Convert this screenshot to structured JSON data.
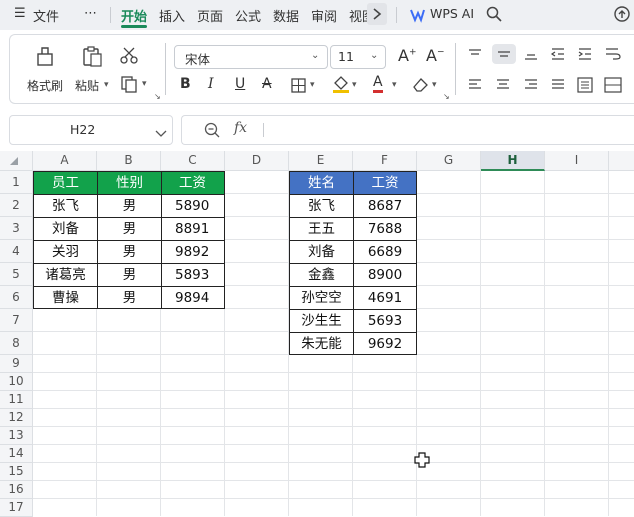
{
  "menubar": {
    "menu_label": "文件",
    "more": "⋯",
    "tabs": [
      "开始",
      "插入",
      "页面",
      "公式",
      "数据",
      "审阅",
      "视图"
    ],
    "wps_ai": "WPS AI"
  },
  "ribbon": {
    "format_painter": "格式刷",
    "paste": "粘贴",
    "font_name": "宋体",
    "font_size": "11",
    "bold": "B",
    "italic": "I",
    "underline": "U",
    "strike": "A",
    "font_color_letter": "A",
    "colors": {
      "fill": "#f0c000",
      "font": "#d32f2f"
    }
  },
  "formula_bar": {
    "cell_ref": "H22",
    "fx": "fx",
    "content": ""
  },
  "sheet": {
    "columns": [
      "A",
      "B",
      "C",
      "D",
      "E",
      "F",
      "G",
      "H",
      "I"
    ],
    "selected_column": "H",
    "rows": [
      "1",
      "2",
      "3",
      "4",
      "5",
      "6",
      "7",
      "8",
      "9",
      "10",
      "11",
      "12",
      "13",
      "14",
      "15",
      "16",
      "17"
    ],
    "table1": {
      "headers": [
        "员工",
        "性别",
        "工资"
      ],
      "rows": [
        [
          "张飞",
          "男",
          "5890"
        ],
        [
          "刘备",
          "男",
          "8891"
        ],
        [
          "关羽",
          "男",
          "9892"
        ],
        [
          "诸葛亮",
          "男",
          "5893"
        ],
        [
          "曹操",
          "男",
          "9894"
        ]
      ],
      "header_color": "#12a24b"
    },
    "table2": {
      "headers": [
        "姓名",
        "工资"
      ],
      "rows": [
        [
          "张飞",
          "8687"
        ],
        [
          "王五",
          "7688"
        ],
        [
          "刘备",
          "6689"
        ],
        [
          "金鑫",
          "8900"
        ],
        [
          "孙空空",
          "4691"
        ],
        [
          "沙生生",
          "5693"
        ],
        [
          "朱无能",
          "9692"
        ]
      ],
      "header_color": "#4472c4"
    }
  }
}
